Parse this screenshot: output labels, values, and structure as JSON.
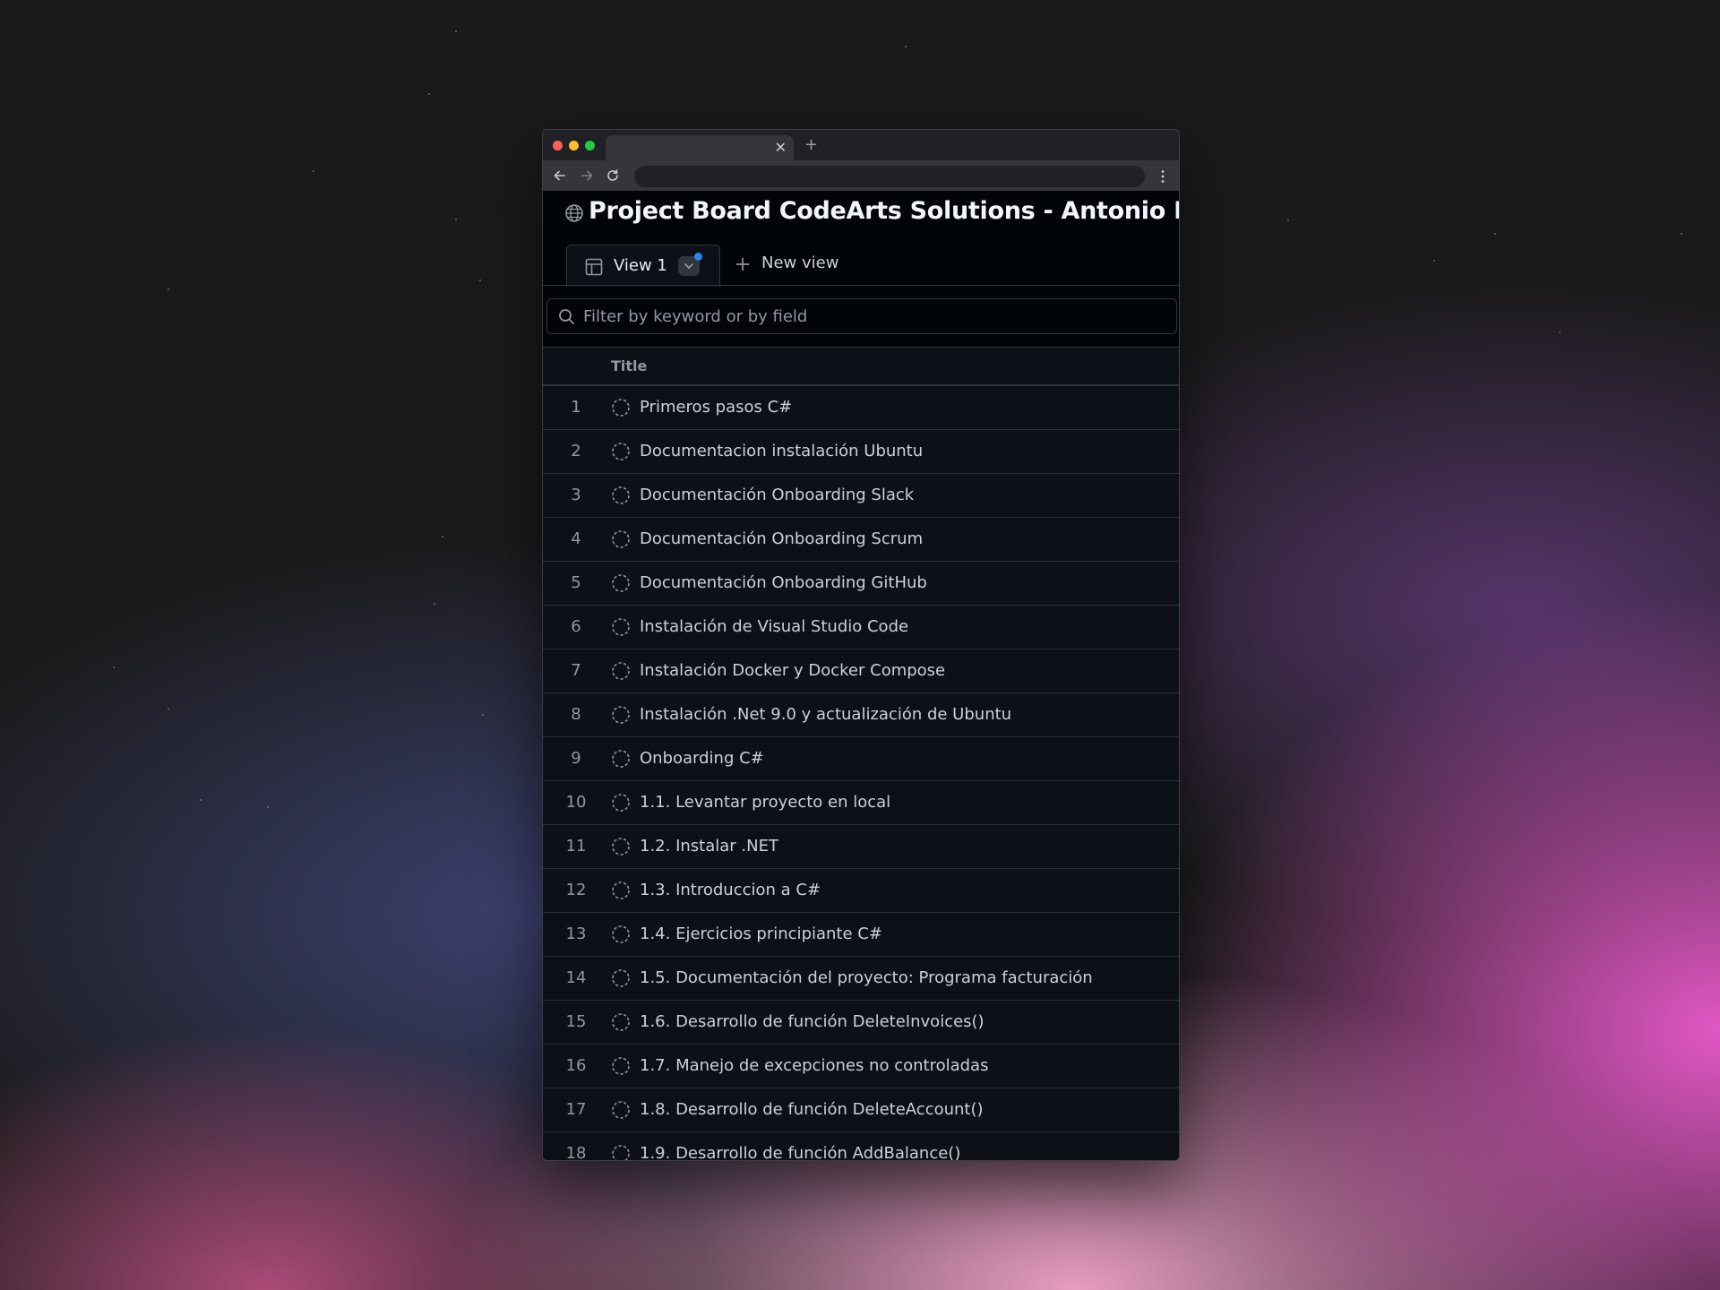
{
  "page": {
    "title": "Project Board CodeArts Solutions - Antonio Plaza"
  },
  "views": {
    "current_tab": "View 1",
    "new_view_label": "New view"
  },
  "filter": {
    "placeholder": "Filter by keyword or by field",
    "value": ""
  },
  "table": {
    "column_title": "Title",
    "rows": [
      {
        "num": "1",
        "title": "Primeros pasos C#"
      },
      {
        "num": "2",
        "title": "Documentacion instalación Ubuntu"
      },
      {
        "num": "3",
        "title": "Documentación Onboarding Slack"
      },
      {
        "num": "4",
        "title": "Documentación Onboarding Scrum"
      },
      {
        "num": "5",
        "title": "Documentación Onboarding GitHub"
      },
      {
        "num": "6",
        "title": "Instalación de Visual Studio Code"
      },
      {
        "num": "7",
        "title": "Instalación Docker y Docker Compose"
      },
      {
        "num": "8",
        "title": "Instalación .Net 9.0 y actualización de Ubuntu"
      },
      {
        "num": "9",
        "title": "Onboarding C#"
      },
      {
        "num": "10",
        "title": "1.1. Levantar proyecto en local"
      },
      {
        "num": "11",
        "title": "1.2. Instalar .NET"
      },
      {
        "num": "12",
        "title": "1.3. Introduccion a C#"
      },
      {
        "num": "13",
        "title": "1.4. Ejercicios principiante C#"
      },
      {
        "num": "14",
        "title": "1.5. Documentación del proyecto: Programa facturación"
      },
      {
        "num": "15",
        "title": "1.6. Desarrollo de función DeleteInvoices()"
      },
      {
        "num": "16",
        "title": "1.7. Manejo de excepciones no controladas"
      },
      {
        "num": "17",
        "title": "1.8. Desarrollo de función DeleteAccount()"
      },
      {
        "num": "18",
        "title": "1.9. Desarrollo de función AddBalance()"
      }
    ]
  },
  "icons": {
    "globe": "globe-icon",
    "table_view": "table-icon",
    "add": "plus-icon",
    "search": "search-icon",
    "item_status": "draft-circle-icon",
    "close_tab": "close-icon",
    "back": "arrow-left-icon",
    "forward": "arrow-right-icon",
    "reload": "reload-icon",
    "menu": "kebab-menu-icon"
  },
  "colors": {
    "page_bg": "#010409",
    "table_bg": "#0d1117",
    "border": "#30363d",
    "text_primary": "#f0f6fc",
    "text_muted": "#9198a1",
    "accent_dot": "#2f81f7"
  }
}
